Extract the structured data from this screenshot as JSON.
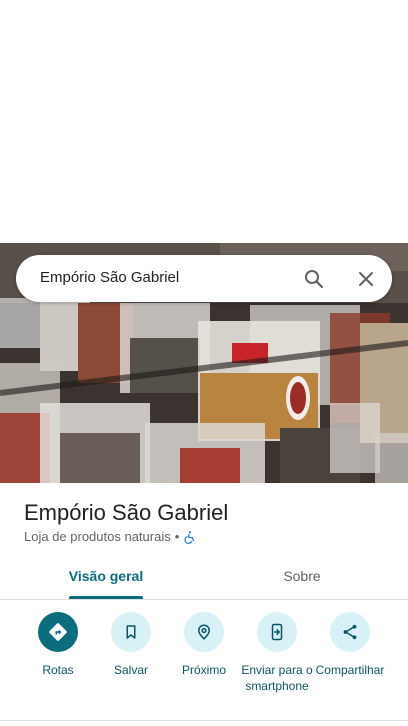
{
  "search": {
    "query": "Empório São Gabriel"
  },
  "place": {
    "name": "Empório São Gabriel",
    "category": "Loja de produtos naturais",
    "separator": "•"
  },
  "tabs": [
    {
      "label": "Visão geral",
      "selected": true
    },
    {
      "label": "Sobre",
      "selected": false
    }
  ],
  "actions": [
    {
      "label": "Rotas",
      "icon": "directions-icon"
    },
    {
      "label": "Salvar",
      "icon": "bookmark-icon"
    },
    {
      "label": "Próximo",
      "icon": "nearby-icon"
    },
    {
      "label": "Enviar para o smartphone",
      "icon": "send-to-phone-icon"
    },
    {
      "label": "Compartilhar",
      "icon": "share-icon"
    }
  ],
  "colors": {
    "accent": "#0b6e7c",
    "action_bg": "#d7f1f6",
    "text_primary": "#202124",
    "text_secondary": "#5f6368"
  }
}
